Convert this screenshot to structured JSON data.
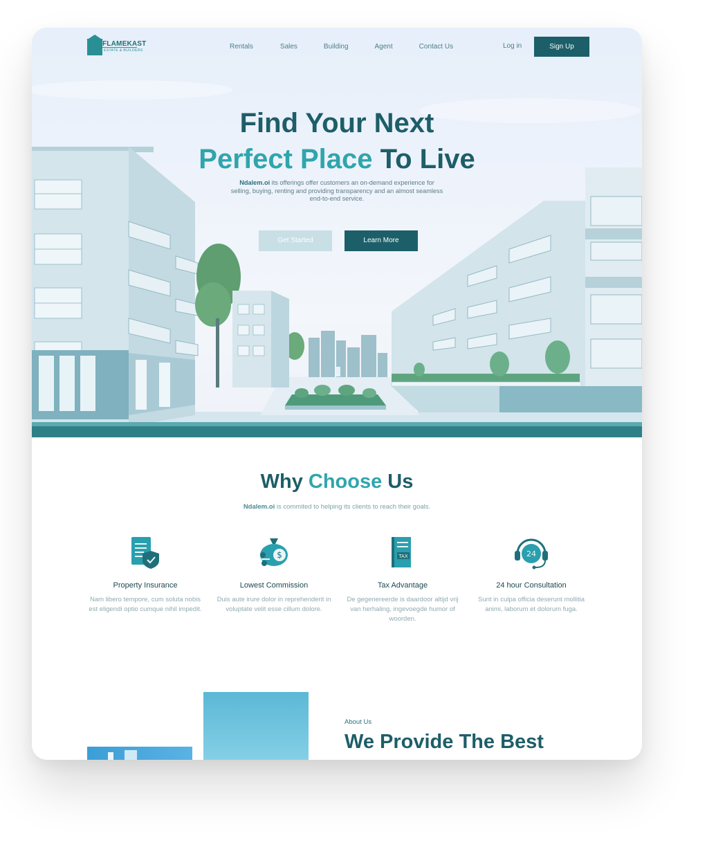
{
  "brand": {
    "name": "FLAMEKAST",
    "tagline": "ESTATE & BUILDERS"
  },
  "nav": {
    "links": [
      "Rentals",
      "Sales",
      "Building",
      "Agent",
      "Contact Us"
    ],
    "login": "Log in",
    "signup": "Sign Up"
  },
  "hero": {
    "title_line1": "Find Your Next",
    "title_accent": "Perfect Place",
    "title_rest": " To Live",
    "desc_brand": "Ndalem.oi",
    "desc": " its offerings offer customers an on-demand experience for selling, buying, renting and providing transparency and an almost seamless end-to-end service.",
    "btn_start": "Get Started",
    "btn_learn": "Learn More"
  },
  "why": {
    "title_pre": "Why ",
    "title_accent": "Choose",
    "title_post": " Us",
    "sub_brand": "Ndalem.oi",
    "sub": " is commited to helping its clients to reach their goals.",
    "features": [
      {
        "icon": "insurance-document-icon",
        "title": "Property Insurance",
        "desc": "Nam libero tempore, cum soluta nobis est eligendi optio cumque nihil impedit."
      },
      {
        "icon": "money-bag-icon",
        "title": "Lowest Commission",
        "desc": "Duis aute irure dolor in reprehenderit in voluptate velit esse cillum dolore."
      },
      {
        "icon": "tax-document-icon",
        "title": "Tax Advantage",
        "desc": "De gegenereerde is daardoor altijd vrij van herhaling, ingevoegde humor of woorden."
      },
      {
        "icon": "headset-24-icon",
        "title": "24 hour Consultation",
        "desc": "Sunt in culpa officia deserunt mollitia animi, laborum et dolorum fuga."
      }
    ]
  },
  "about": {
    "kicker": "About Us",
    "title": "We Provide The Best"
  },
  "colors": {
    "primary": "#1c5f69",
    "accent": "#2fa5ad",
    "muted": "#c8dfe6"
  }
}
